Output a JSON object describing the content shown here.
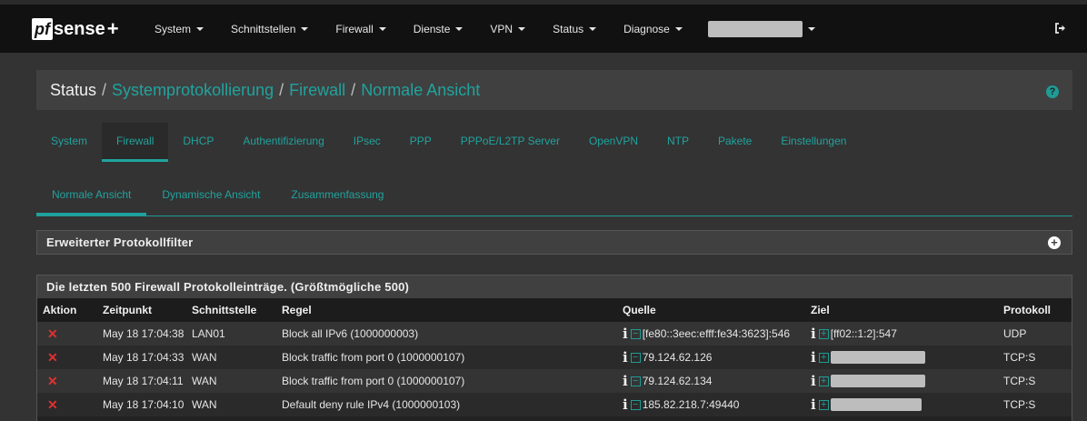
{
  "navbar": {
    "brand_pf": "pf",
    "brand_sense": "sense",
    "brand_plus": "+",
    "menu": [
      "System",
      "Schnittstellen",
      "Firewall",
      "Dienste",
      "VPN",
      "Status",
      "Diagnose"
    ]
  },
  "breadcrumb": {
    "root": "Status",
    "items": [
      "Systemprotokollierung",
      "Firewall",
      "Normale Ansicht"
    ]
  },
  "tabs": [
    "System",
    "Firewall",
    "DHCP",
    "Authentifizierung",
    "IPsec",
    "PPP",
    "PPPoE/L2TP Server",
    "OpenVPN",
    "NTP",
    "Pakete",
    "Einstellungen"
  ],
  "subtabs": [
    "Normale Ansicht",
    "Dynamische Ansicht",
    "Zusammenfassung"
  ],
  "filter_panel": {
    "title": "Erweiterter Protokollfilter"
  },
  "log_panel": {
    "title": "Die letzten 500 Firewall Protokolleinträge. (Größtmögliche 500)",
    "columns": [
      "Aktion",
      "Zeitpunkt",
      "Schnittstelle",
      "Regel",
      "Quelle",
      "Ziel",
      "Protokoll"
    ],
    "rows": [
      {
        "action": "✕",
        "time": "May 18 17:04:38",
        "iface": "LAN01",
        "rule": "Block all IPv6 (1000000003)",
        "source": "[fe80::3eec:efff:fe34:3623]:546",
        "dest": "[ff02::1:2]:547",
        "proto": "UDP"
      },
      {
        "action": "✕",
        "time": "May 18 17:04:33",
        "iface": "WAN",
        "rule": "Block traffic from port 0 (1000000107)",
        "source": "79.124.62.126",
        "dest": "",
        "proto": "TCP:S"
      },
      {
        "action": "✕",
        "time": "May 18 17:04:11",
        "iface": "WAN",
        "rule": "Block traffic from port 0 (1000000107)",
        "source": "79.124.62.134",
        "dest": "",
        "proto": "TCP:S"
      },
      {
        "action": "✕",
        "time": "May 18 17:04:10",
        "iface": "WAN",
        "rule": "Default deny rule IPv4 (1000000103)",
        "source": "185.82.218.7:49440",
        "dest": "",
        "proto": "TCP:S"
      }
    ]
  },
  "icons": {
    "info_glyph": "i",
    "minus_glyph": "−",
    "plus_glyph": "+",
    "help_glyph": "?"
  }
}
